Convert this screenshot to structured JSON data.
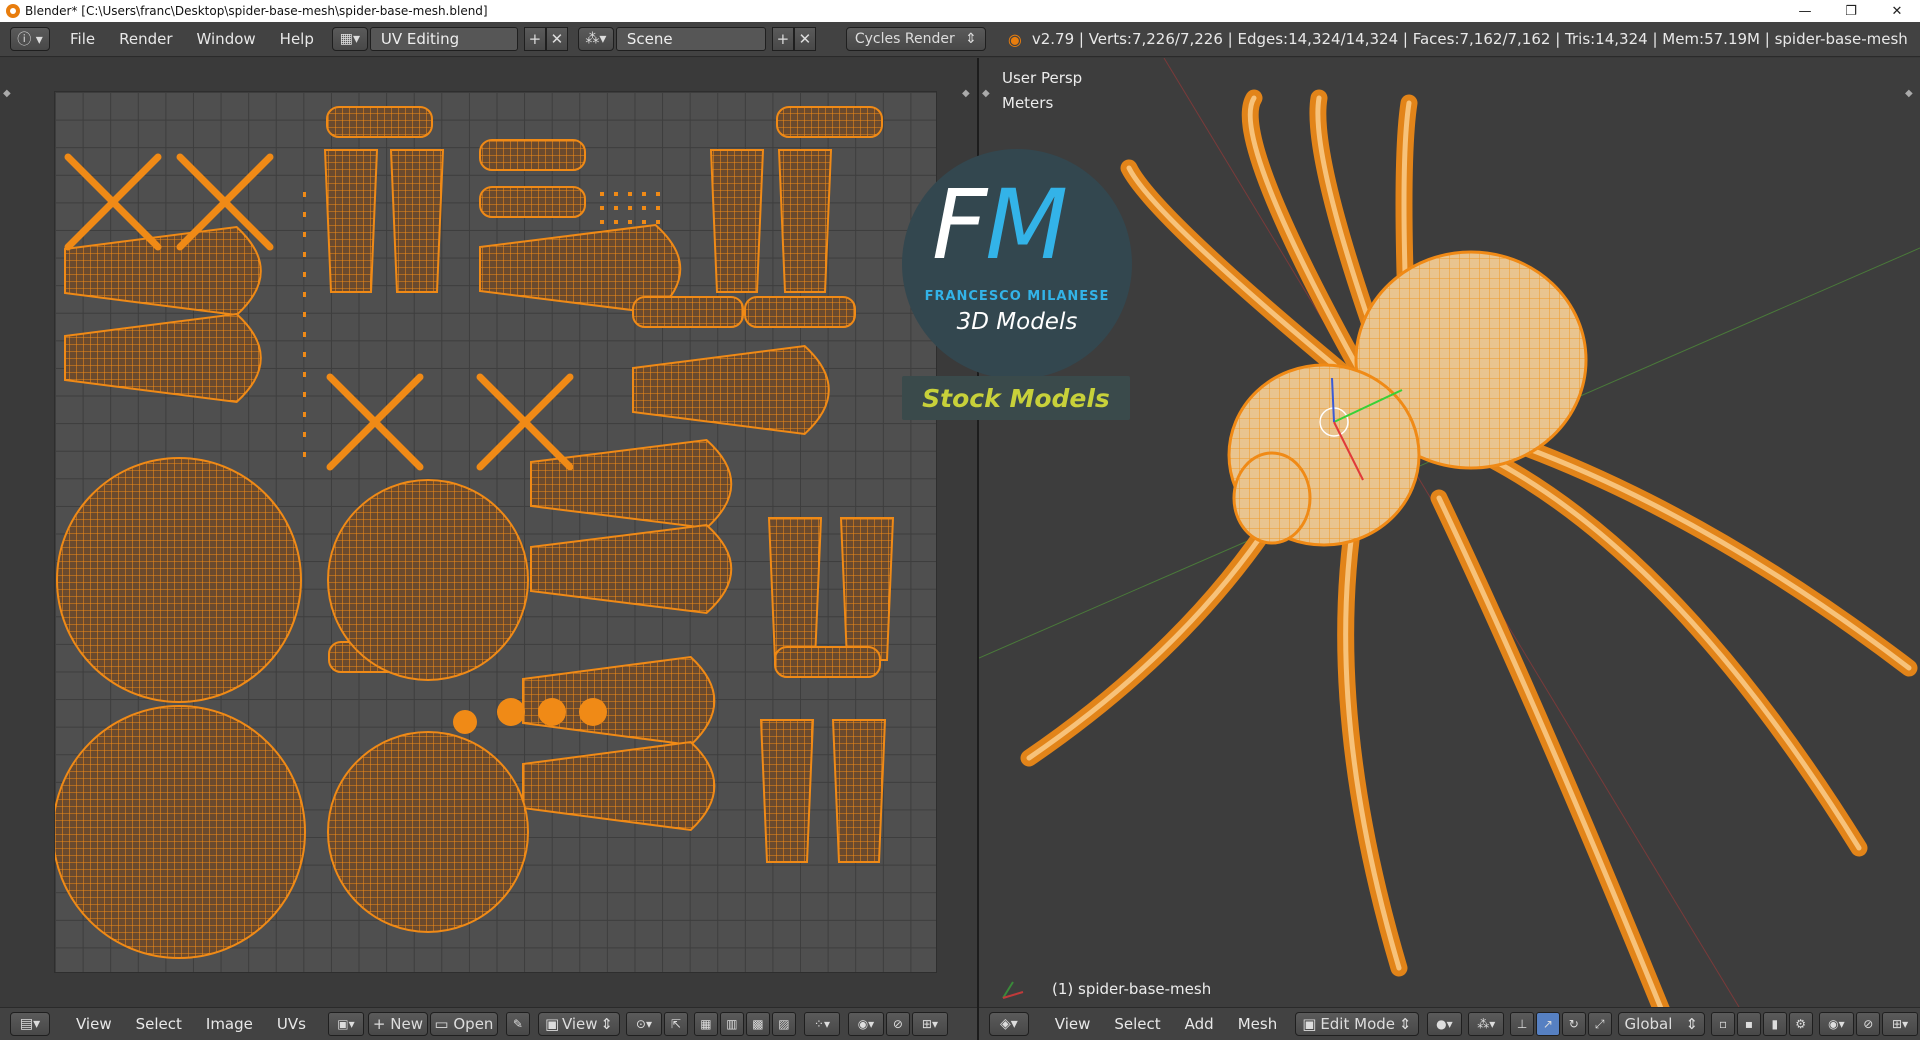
{
  "window": {
    "title": "Blender* [C:\\Users\\franc\\Desktop\\spider-base-mesh\\spider-base-mesh.blend]",
    "minimize": "—",
    "restore": "❐",
    "close": "✕"
  },
  "info_header": {
    "menus": [
      "File",
      "Render",
      "Window",
      "Help"
    ],
    "screen_layout": "UV Editing",
    "scene": "Scene",
    "render_engine": "Cycles Render",
    "stats": "v2.79 | Verts:7,226/7,226 | Edges:14,324/14,324 | Faces:7,162/7,162 | Tris:14,324 | Mem:57.19M | spider-base-mesh"
  },
  "uv_editor": {
    "menus": [
      "View",
      "Select",
      "Image",
      "UVs"
    ],
    "new_label": "New",
    "open_label": "Open",
    "view_label": "View"
  },
  "viewport": {
    "perspective": "User Persp",
    "units": "Meters",
    "object_label": "(1) spider-base-mesh",
    "menus": [
      "View",
      "Select",
      "Add",
      "Mesh"
    ],
    "mode": "Edit Mode",
    "orientation": "Global"
  },
  "watermark": {
    "initials_f": "F",
    "initials_m": "M",
    "name": "FRANCESCO MILANESE",
    "subtitle": "3D Models",
    "banner": "Stock Models"
  },
  "colors": {
    "accent_orange": "#f08a16",
    "panel_bg": "#393939",
    "header_bg": "#424242",
    "logo_blue": "#33b3e8",
    "logo_yellow": "#c8d13a"
  },
  "icons": [
    "blender-icon",
    "info-editor-icon",
    "screen-layout-icon",
    "scene-icon",
    "render-icon",
    "image-editor-icon",
    "view3d-editor-icon",
    "pivot-icon",
    "shading-icon",
    "manipulator-icon",
    "mode-icon"
  ]
}
